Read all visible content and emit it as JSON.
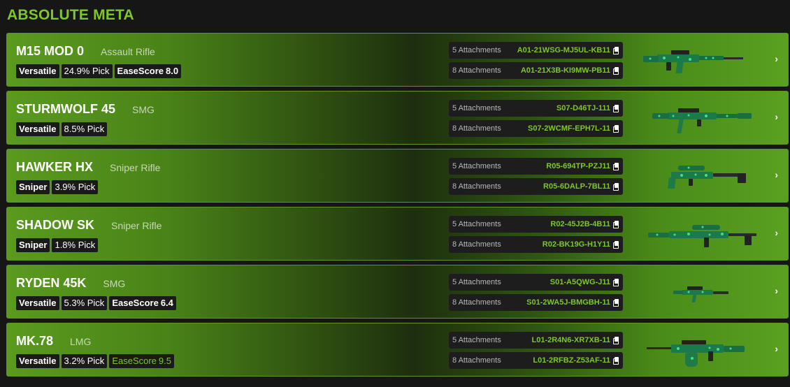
{
  "heading": "ABSOLUTE META",
  "weapons": [
    {
      "name": "M15 MOD 0",
      "class": "Assault Rifle",
      "tag1": "Versatile",
      "pick": "24.9% Pick",
      "ease_label": "EaseScore",
      "ease_value": "8.0",
      "codes": [
        {
          "label": "5 Attachments",
          "value": "A01-21WSG-MJ5UL-KB11"
        },
        {
          "label": "8 Attachments",
          "value": "A01-21X3B-KI9MW-PB11"
        }
      ]
    },
    {
      "name": "STURMWOLF 45",
      "class": "SMG",
      "tag1": "Versatile",
      "pick": "8.5% Pick",
      "codes": [
        {
          "label": "5 Attachments",
          "value": "S07-D46TJ-111"
        },
        {
          "label": "8 Attachments",
          "value": "S07-2WCMF-EPH7L-11"
        }
      ]
    },
    {
      "name": "HAWKER HX",
      "class": "Sniper Rifle",
      "tag1": "Sniper",
      "pick": "3.9% Pick",
      "codes": [
        {
          "label": "5 Attachments",
          "value": "R05-694TP-PZJ11"
        },
        {
          "label": "8 Attachments",
          "value": "R05-6DALP-7BL11"
        }
      ]
    },
    {
      "name": "SHADOW SK",
      "class": "Sniper Rifle",
      "tag1": "Sniper",
      "pick": "1.8% Pick",
      "codes": [
        {
          "label": "5 Attachments",
          "value": "R02-45J2B-4B11"
        },
        {
          "label": "8 Attachments",
          "value": "R02-BK19G-H1Y11"
        }
      ]
    },
    {
      "name": "RYDEN 45K",
      "class": "SMG",
      "tag1": "Versatile",
      "pick": "5.3% Pick",
      "ease_label": "EaseScore",
      "ease_value": "6.4",
      "codes": [
        {
          "label": "5 Attachments",
          "value": "S01-A5QWG-J11"
        },
        {
          "label": "8 Attachments",
          "value": "S01-2WA5J-BMGBH-11"
        }
      ]
    },
    {
      "name": "MK.78",
      "class": "LMG",
      "tag1": "Versatile",
      "pick": "3.2% Pick",
      "ease_label": "EaseScore",
      "ease_value": "9.5",
      "codes": [
        {
          "label": "5 Attachments",
          "value": "L01-2R4N6-XR7XB-11"
        },
        {
          "label": "8 Attachments",
          "value": "L01-2RFBZ-Z53AF-11"
        }
      ]
    }
  ],
  "icons": {
    "copy": "copy-icon",
    "chevron": "chevron-right-icon"
  },
  "colors": {
    "accent": "#7ec62a",
    "background": "#161616",
    "tag_bg": "#1a1a1a",
    "camo": "#19c060"
  }
}
